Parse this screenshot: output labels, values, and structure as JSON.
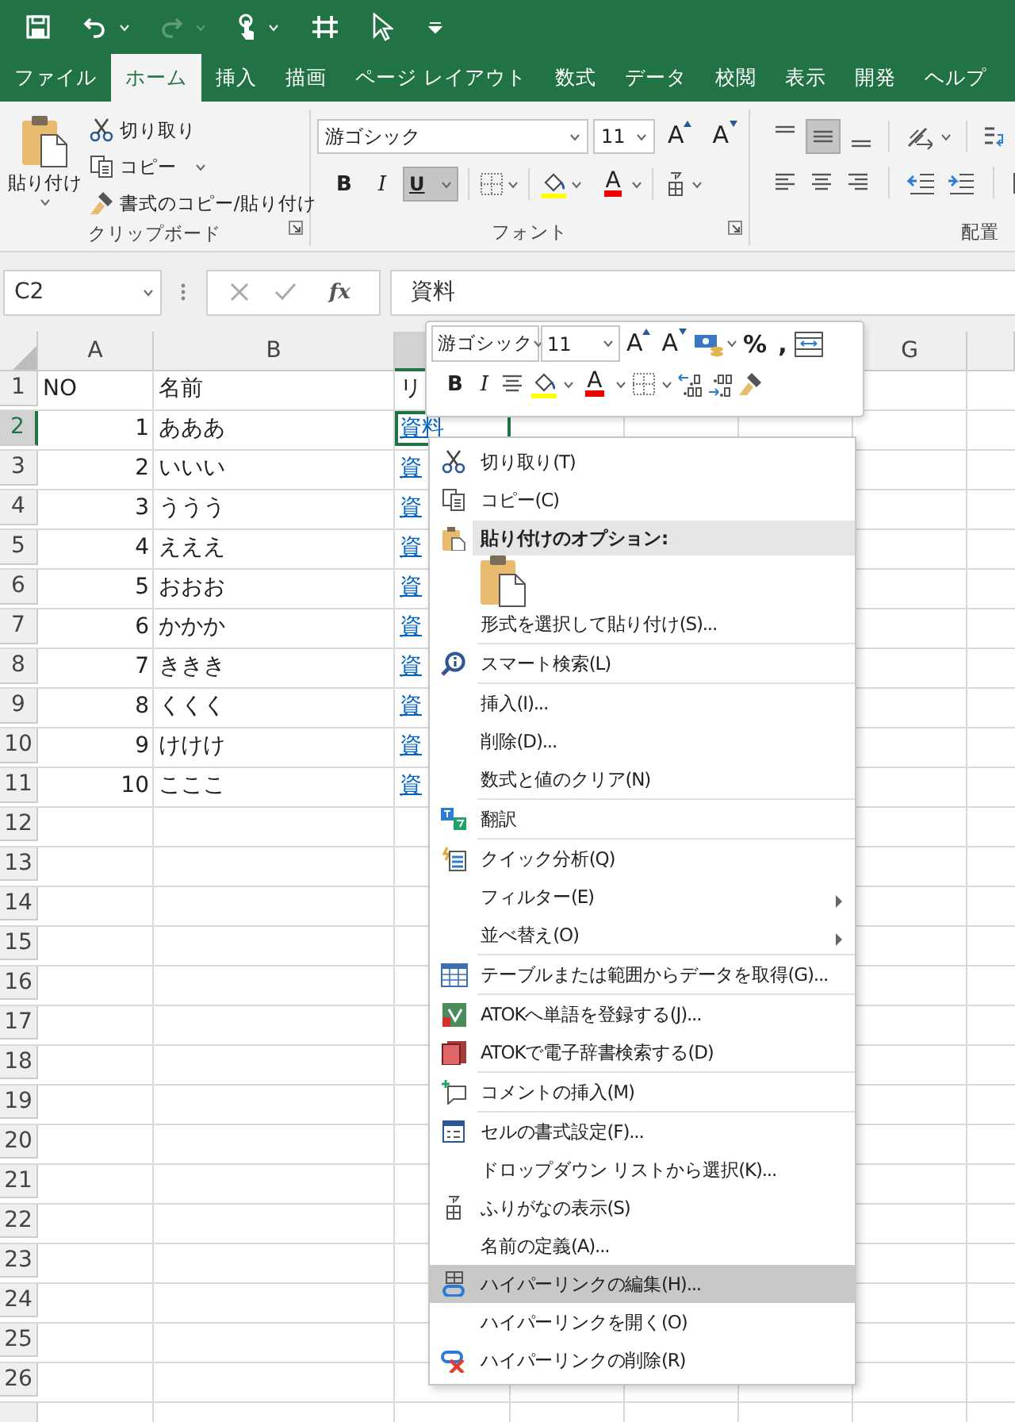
{
  "quick_access_toolbar": {
    "redo_disabled": true
  },
  "tabs": [
    {
      "label": "ファイル",
      "selected": false
    },
    {
      "label": "ホーム",
      "selected": true
    },
    {
      "label": "挿入",
      "selected": false
    },
    {
      "label": "描画",
      "selected": false
    },
    {
      "label": "ページ レイアウト",
      "selected": false
    },
    {
      "label": "数式",
      "selected": false
    },
    {
      "label": "データ",
      "selected": false
    },
    {
      "label": "校閲",
      "selected": false
    },
    {
      "label": "表示",
      "selected": false
    },
    {
      "label": "開発",
      "selected": false
    },
    {
      "label": "ヘルプ",
      "selected": false
    }
  ],
  "ribbon": {
    "clipboard": {
      "paste": "貼り付け",
      "cut": "切り取り",
      "copy": "コピー",
      "format_painter": "書式のコピー/貼り付け",
      "label": "クリップボード"
    },
    "font": {
      "font_name": "游ゴシック",
      "font_size": "11",
      "grow_font": "A",
      "shrink_font": "A",
      "bold": "B",
      "italic": "I",
      "underline": "U",
      "underline_pressed": true,
      "font_color": "A",
      "label": "フォント"
    },
    "alignment": {
      "middle_align_pressed": true,
      "label": "配置"
    }
  },
  "formula_bar": {
    "name_box": "C2",
    "function_label": "fx",
    "value": "資料"
  },
  "sheet": {
    "columns": [
      {
        "label": "A",
        "selected": false
      },
      {
        "label": "B",
        "selected": false
      },
      {
        "selected": true
      },
      {
        "label": "G",
        "selected": false
      },
      {
        "selected": false
      }
    ],
    "rows": [
      {
        "label": "1",
        "selected": false,
        "cells": [
          {
            "text": "NO",
            "kind": "text"
          },
          {
            "text": "名前",
            "kind": "text"
          },
          {
            "text": "リ",
            "kind": "text"
          }
        ]
      },
      {
        "label": "2",
        "selected": true,
        "cells": [
          {
            "text": "1",
            "kind": "number"
          },
          {
            "text": "あああ",
            "kind": "text"
          },
          {
            "text": "資料",
            "kind": "link"
          }
        ]
      },
      {
        "label": "3",
        "selected": false,
        "cells": [
          {
            "text": "2",
            "kind": "number"
          },
          {
            "text": "いいい",
            "kind": "text"
          },
          {
            "text": "資",
            "kind": "link"
          }
        ]
      },
      {
        "label": "4",
        "selected": false,
        "cells": [
          {
            "text": "3",
            "kind": "number"
          },
          {
            "text": "ううう",
            "kind": "text"
          },
          {
            "text": "資",
            "kind": "link"
          }
        ]
      },
      {
        "label": "5",
        "selected": false,
        "cells": [
          {
            "text": "4",
            "kind": "number"
          },
          {
            "text": "えええ",
            "kind": "text"
          },
          {
            "text": "資",
            "kind": "link"
          }
        ]
      },
      {
        "label": "6",
        "selected": false,
        "cells": [
          {
            "text": "5",
            "kind": "number"
          },
          {
            "text": "おおお",
            "kind": "text"
          },
          {
            "text": "資",
            "kind": "link"
          }
        ]
      },
      {
        "label": "7",
        "selected": false,
        "cells": [
          {
            "text": "6",
            "kind": "number"
          },
          {
            "text": "かかか",
            "kind": "text"
          },
          {
            "text": "資",
            "kind": "link"
          }
        ]
      },
      {
        "label": "8",
        "selected": false,
        "cells": [
          {
            "text": "7",
            "kind": "number"
          },
          {
            "text": "ききき",
            "kind": "text"
          },
          {
            "text": "資",
            "kind": "link"
          }
        ]
      },
      {
        "label": "9",
        "selected": false,
        "cells": [
          {
            "text": "8",
            "kind": "number"
          },
          {
            "text": "くくく",
            "kind": "text"
          },
          {
            "text": "資",
            "kind": "link"
          }
        ]
      },
      {
        "label": "10",
        "selected": false,
        "cells": [
          {
            "text": "9",
            "kind": "number"
          },
          {
            "text": "けけけ",
            "kind": "text"
          },
          {
            "text": "資",
            "kind": "link"
          }
        ]
      },
      {
        "label": "11",
        "selected": false,
        "cells": [
          {
            "text": "10",
            "kind": "number"
          },
          {
            "text": "こここ",
            "kind": "text"
          },
          {
            "text": "資",
            "kind": "link"
          }
        ]
      },
      {
        "label": "12",
        "selected": false
      },
      {
        "label": "13",
        "selected": false
      },
      {
        "label": "14",
        "selected": false
      },
      {
        "label": "15",
        "selected": false
      },
      {
        "label": "16",
        "selected": false
      },
      {
        "label": "17",
        "selected": false
      },
      {
        "label": "18",
        "selected": false
      },
      {
        "label": "19",
        "selected": false
      },
      {
        "label": "20",
        "selected": false
      },
      {
        "label": "21",
        "selected": false
      },
      {
        "label": "22",
        "selected": false
      },
      {
        "label": "23",
        "selected": false
      },
      {
        "label": "24",
        "selected": false
      },
      {
        "label": "25",
        "selected": false
      },
      {
        "label": "26",
        "selected": false
      }
    ]
  },
  "mini_toolbar": {
    "font_name": "游ゴシック",
    "font_size": "11",
    "grow_font": "A",
    "shrink_font": "A",
    "percent": "%",
    "comma": ",",
    "bold": "B",
    "italic": "I",
    "font_color": "A"
  },
  "context_menu": {
    "items": [
      {
        "kind": "item",
        "label": "切り取り(T)",
        "selected": false,
        "submenu": false
      },
      {
        "kind": "item",
        "label": "コピー(C)",
        "selected": false,
        "submenu": false
      },
      {
        "kind": "header",
        "label": "貼り付けのオプション:"
      },
      {
        "kind": "paste_options"
      },
      {
        "kind": "item",
        "label": "形式を選択して貼り付け(S)...",
        "selected": false,
        "submenu": false
      },
      {
        "kind": "separator"
      },
      {
        "kind": "item",
        "label": "スマート検索(L)",
        "selected": false,
        "submenu": false
      },
      {
        "kind": "separator"
      },
      {
        "kind": "item",
        "label": "挿入(I)...",
        "selected": false,
        "submenu": false
      },
      {
        "kind": "item",
        "label": "削除(D)...",
        "selected": false,
        "submenu": false
      },
      {
        "kind": "item",
        "label": "数式と値のクリア(N)",
        "selected": false,
        "submenu": false
      },
      {
        "kind": "separator"
      },
      {
        "kind": "item",
        "label": "翻訳",
        "selected": false,
        "submenu": false
      },
      {
        "kind": "separator"
      },
      {
        "kind": "item",
        "label": "クイック分析(Q)",
        "selected": false,
        "submenu": false
      },
      {
        "kind": "item",
        "label": "フィルター(E)",
        "selected": false,
        "submenu": true
      },
      {
        "kind": "item",
        "label": "並べ替え(O)",
        "selected": false,
        "submenu": true
      },
      {
        "kind": "separator"
      },
      {
        "kind": "item",
        "label": "テーブルまたは範囲からデータを取得(G)...",
        "selected": false,
        "submenu": false
      },
      {
        "kind": "separator"
      },
      {
        "kind": "item",
        "label": "ATOKへ単語を登録する(J)...",
        "selected": false,
        "submenu": false
      },
      {
        "kind": "item",
        "label": "ATOKで電子辞書検索する(D)",
        "selected": false,
        "submenu": false
      },
      {
        "kind": "separator"
      },
      {
        "kind": "item",
        "label": "コメントの挿入(M)",
        "selected": false,
        "submenu": false
      },
      {
        "kind": "separator"
      },
      {
        "kind": "item",
        "label": "セルの書式設定(F)...",
        "selected": false,
        "submenu": false
      },
      {
        "kind": "item",
        "label": "ドロップダウン リストから選択(K)...",
        "selected": false,
        "submenu": false
      },
      {
        "kind": "item",
        "label": "ふりがなの表示(S)",
        "selected": false,
        "submenu": false
      },
      {
        "kind": "item",
        "label": "名前の定義(A)...",
        "selected": false,
        "submenu": false
      },
      {
        "kind": "item",
        "label": "ハイパーリンクの編集(H)...",
        "selected": true,
        "submenu": false
      },
      {
        "kind": "item",
        "label": "ハイパーリンクを開く(O)",
        "selected": false,
        "submenu": false
      },
      {
        "kind": "item",
        "label": "ハイパーリンクの削除(R)",
        "selected": false,
        "submenu": false
      }
    ]
  }
}
